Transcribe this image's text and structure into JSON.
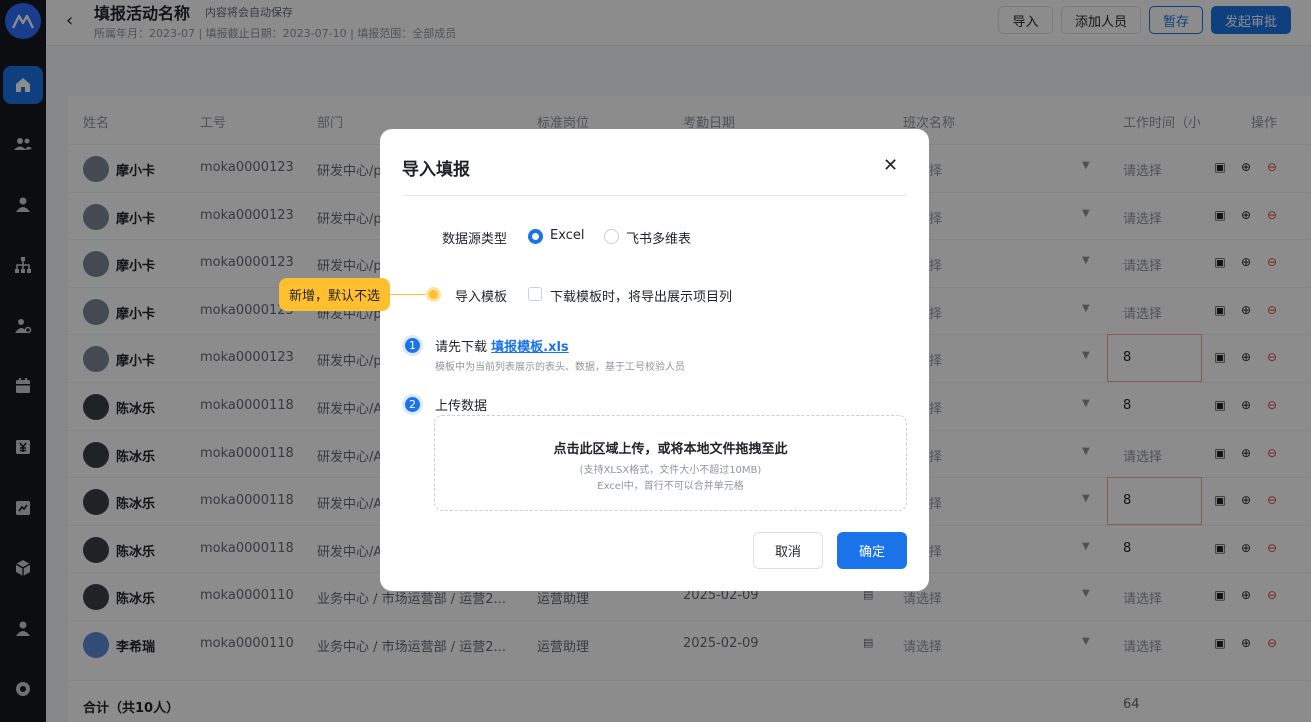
{
  "header": {
    "title": "填报活动名称",
    "autosave": "内容将会自动保存",
    "meta": "所属年月：2023-07 | 填报截止日期：2023-07-10 | 填报范围：全部成员",
    "buttons": {
      "import": "导入",
      "add_member": "添加人员",
      "save_draft": "暂存",
      "submit": "发起审批"
    }
  },
  "table": {
    "columns": [
      "姓名",
      "工号",
      "部门",
      "标准岗位",
      "考勤日期",
      "班次名称",
      "工作时间（小",
      "操作"
    ],
    "placeholder": "请选择",
    "rows": [
      {
        "name": "摩小卡",
        "id": "moka0000123",
        "dept": "研发中心/p",
        "hours": ""
      },
      {
        "name": "摩小卡",
        "id": "moka0000123",
        "dept": "研发中心/p",
        "hours": ""
      },
      {
        "name": "摩小卡",
        "id": "moka0000123",
        "dept": "研发中心/p",
        "hours": ""
      },
      {
        "name": "摩小卡",
        "id": "moka0000123",
        "dept": "研发中心/p",
        "hours": ""
      },
      {
        "name": "摩小卡",
        "id": "moka0000123",
        "dept": "研发中心/p",
        "hours": "8"
      },
      {
        "name": "陈冰乐",
        "id": "moka0000118",
        "dept": "研发中心/A",
        "hours": "8"
      },
      {
        "name": "陈冰乐",
        "id": "moka0000118",
        "dept": "研发中心/A",
        "hours": ""
      },
      {
        "name": "陈冰乐",
        "id": "moka0000118",
        "dept": "研发中心/A",
        "hours": "8"
      },
      {
        "name": "陈冰乐",
        "id": "moka0000118",
        "dept": "研发中心/A",
        "hours": "8"
      },
      {
        "name": "陈冰乐",
        "id": "moka0000110",
        "dept": "业务中心 / 市场运营部 / 运营2...",
        "post": "运营助理",
        "date": "2025-02-09",
        "hours": ""
      },
      {
        "name": "李希瑞",
        "id": "moka0000110",
        "dept": "业务中心 / 市场运营部 / 运营2...",
        "post": "运营助理",
        "date": "2025-02-09",
        "hours": ""
      }
    ],
    "total_label": "合计（共10人）",
    "total_hours": "64"
  },
  "modal": {
    "title": "导入填报",
    "source_label": "数据源类型",
    "source_options": [
      "Excel",
      "飞书多维表"
    ],
    "template_label": "导入模板",
    "template_checkbox": "下载模板时，将导出展示项目列",
    "step1_prefix": "请先下载",
    "step1_link": "填报模板.xls",
    "step1_hint": "模板中为当前列表展示的表头、数据，基于工号校验人员",
    "step2_label": "上传数据",
    "upload_main": "点击此区域上传，或将本地文件拖拽至此",
    "upload_sub1": "(支持XLSX格式，文件大小不超过10MB)",
    "upload_sub2": "Excel中，首行不可以合并单元格",
    "cancel": "取消",
    "confirm": "确定",
    "step_numbers": [
      "1",
      "2"
    ]
  },
  "callout": "新增，默认不选",
  "colors": {
    "primary": "#1a73e8",
    "sidebar": "#15181f",
    "callout": "#ffbf2e"
  }
}
